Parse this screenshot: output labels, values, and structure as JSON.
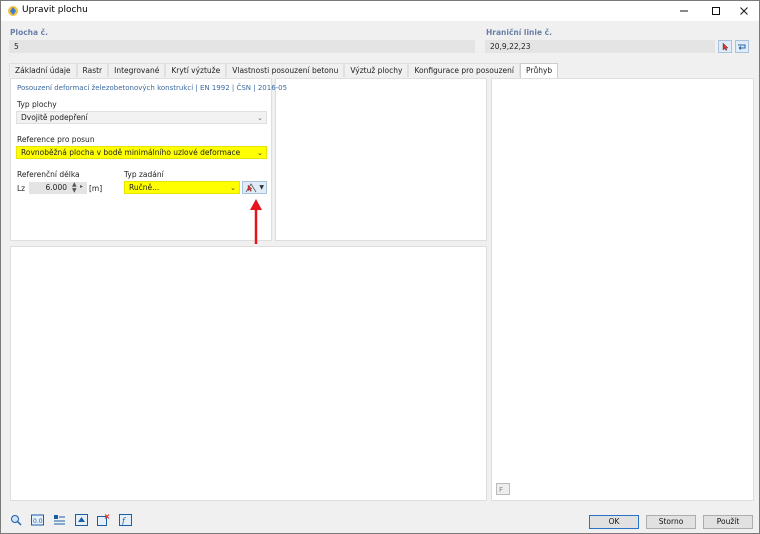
{
  "window": {
    "title": "Upravit plochu"
  },
  "header": {
    "surface_label": "Plocha č.",
    "surface_value": "5",
    "boundary_label": "Hraniční linie č.",
    "boundary_value": "20,9,22,23"
  },
  "tabs": [
    {
      "label": "Základní údaje"
    },
    {
      "label": "Rastr"
    },
    {
      "label": "Integrované"
    },
    {
      "label": "Krytí výztuže"
    },
    {
      "label": "Vlastnosti posouzení betonu"
    },
    {
      "label": "Výztuž plochy"
    },
    {
      "label": "Konfigurace pro posouzení"
    },
    {
      "label": "Průhyb"
    }
  ],
  "deflection": {
    "section_title": "Posouzení deformací železobetonových konstrukcí | EN 1992 | ČSN | 2016-05",
    "support_type_label": "Typ plochy",
    "support_type_value": "Dvojitě podepření",
    "reference_label": "Reference pro posun",
    "reference_value": "Rovnoběžná plocha v bodě minimálního uzlové deformace",
    "ref_length_label": "Referenční délka",
    "lz_symbol": "Lz",
    "lz_value": "6.000",
    "lz_unit": "[m]",
    "input_type_label": "Typ zadání",
    "input_type_value": "Ručně..."
  },
  "footer": {
    "ok": "OK",
    "cancel": "Storno",
    "apply": "Použít"
  },
  "colors": {
    "highlight": "#ffff00",
    "accent_text": "#3d6aa0",
    "arrow": "#e8141c"
  }
}
